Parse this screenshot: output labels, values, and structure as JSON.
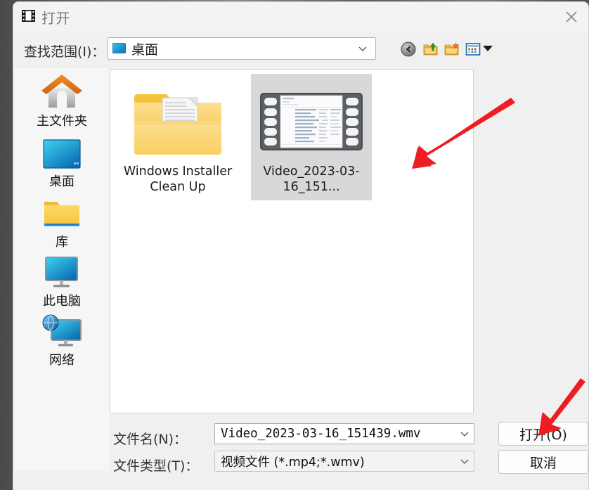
{
  "window": {
    "title": "打开",
    "title_icon": "film-strip-icon",
    "close_label": "✕"
  },
  "lookin": {
    "label": "查找范围(I)：",
    "value": "桌面",
    "icon": "desktop-icon",
    "chevron": "chevron-down-icon"
  },
  "toolbar": {
    "buttons": [
      {
        "name": "back-button",
        "tooltip": "后退"
      },
      {
        "name": "up-one-level-button",
        "tooltip": "向上一级"
      },
      {
        "name": "new-folder-button",
        "tooltip": "新建文件夹"
      },
      {
        "name": "views-button",
        "tooltip": "查看"
      }
    ],
    "views_dropdown_arrow": "caret-down-icon"
  },
  "places": [
    {
      "label": "主文件夹",
      "icon": "home-icon"
    },
    {
      "label": "桌面",
      "icon": "desktop-icon"
    },
    {
      "label": "库",
      "icon": "folder-icon"
    },
    {
      "label": "此电脑",
      "icon": "computer-icon"
    },
    {
      "label": "网络",
      "icon": "network-icon"
    }
  ],
  "files": [
    {
      "label": "Windows Installer Clean Up",
      "icon": "open-folder-with-document-icon",
      "selected": false
    },
    {
      "label": "Video_2023-03-16_151...",
      "icon": "film-thumbnail-icon",
      "selected": true
    }
  ],
  "fields": {
    "filename_label": "文件名(N)：",
    "filename_value": "Video_2023-03-16_151439.wmv",
    "filetype_label": "文件类型(T)：",
    "filetype_value": "视频文件 (*.mp4;*.wmv)",
    "chevron": "chevron-down-icon"
  },
  "buttons": {
    "open": "打开(O)",
    "cancel": "取消"
  },
  "annotations": {
    "arrow_color": "#ee1c23",
    "arrow_1_target": "selected-file-thumbnail",
    "arrow_2_target": "open-button"
  },
  "colors": {
    "window_bg": "#f0f0f0",
    "panel_bg": "#ffffff",
    "selection": "#d8d8d8",
    "title_text": "#7b7b7b",
    "accent_red": "#ee1c23"
  }
}
